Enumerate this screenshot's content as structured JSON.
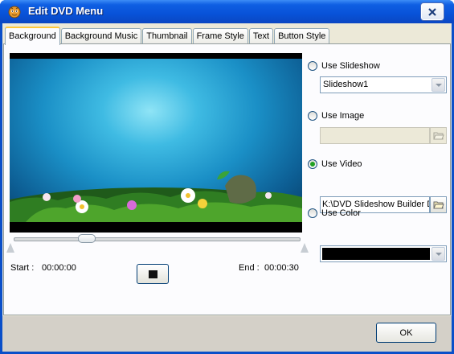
{
  "window": {
    "title": "Edit DVD Menu"
  },
  "tabs": [
    {
      "label": "Background",
      "active": true
    },
    {
      "label": "Background Music"
    },
    {
      "label": "Thumbnail"
    },
    {
      "label": "Frame Style"
    },
    {
      "label": "Text"
    },
    {
      "label": "Button Style"
    }
  ],
  "preview": {
    "start_label": "Start :",
    "start_time": "00:00:00",
    "end_label": "End :",
    "end_time": "00:00:30",
    "position_fraction": 0.24
  },
  "options": {
    "slideshow": {
      "label": "Use Slideshow",
      "checked": false,
      "value": "Slideshow1"
    },
    "image": {
      "label": "Use Image",
      "checked": false,
      "value": ""
    },
    "video": {
      "label": "Use Video",
      "checked": true,
      "value": "K:\\DVD Slideshow Builder De"
    },
    "color": {
      "label": "Use Color",
      "checked": false,
      "value_color": "#000000"
    }
  },
  "footer": {
    "ok_label": "OK"
  },
  "icons": [
    "app-icon",
    "close-icon",
    "stop-icon",
    "dropdown-arrow-icon",
    "folder-open-icon"
  ]
}
